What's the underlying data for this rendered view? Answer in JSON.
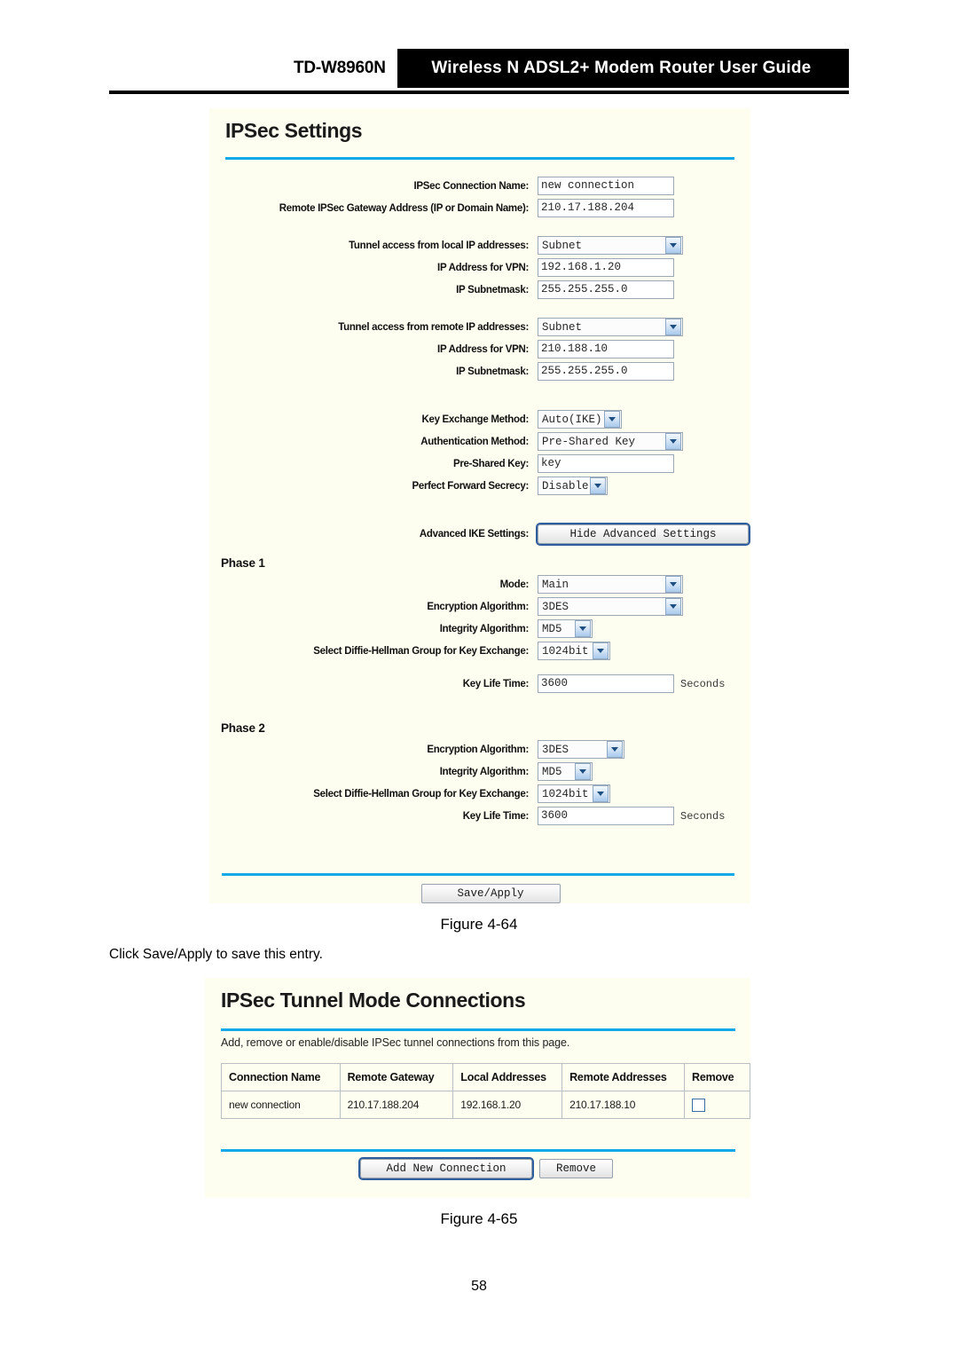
{
  "header": {
    "model": "TD-W8960N",
    "title": "Wireless N ADSL2+ Modem Router User Guide"
  },
  "settings_panel": {
    "title": "IPSec Settings",
    "fields": {
      "connection_name": {
        "label": "IPSec Connection Name:",
        "value": "new connection"
      },
      "remote_gateway": {
        "label": "Remote IPSec Gateway Address (IP or Domain Name):",
        "value": "210.17.188.204"
      },
      "local_tunnel_access": {
        "label": "Tunnel access from local IP addresses:",
        "value": "Subnet"
      },
      "local_ip_vpn": {
        "label": "IP Address for VPN:",
        "value": "192.168.1.20"
      },
      "local_subnetmask": {
        "label": "IP Subnetmask:",
        "value": "255.255.255.0"
      },
      "remote_tunnel_access": {
        "label": "Tunnel access from remote IP addresses:",
        "value": "Subnet"
      },
      "remote_ip_vpn": {
        "label": "IP Address for VPN:",
        "value": "210.188.10"
      },
      "remote_subnetmask": {
        "label": "IP Subnetmask:",
        "value": "255.255.255.0"
      },
      "key_exchange_method": {
        "label": "Key Exchange Method:",
        "value": "Auto(IKE)"
      },
      "authentication_method": {
        "label": "Authentication Method:",
        "value": "Pre-Shared Key"
      },
      "pre_shared_key": {
        "label": "Pre-Shared Key:",
        "value": "key"
      },
      "perfect_forward_secrecy": {
        "label": "Perfect Forward Secrecy:",
        "value": "Disable"
      },
      "advanced_ike": {
        "label": "Advanced IKE Settings:",
        "button": "Hide Advanced Settings"
      }
    },
    "phase1": {
      "heading": "Phase 1",
      "mode": {
        "label": "Mode:",
        "value": "Main"
      },
      "encryption_algorithm": {
        "label": "Encryption Algorithm:",
        "value": "3DES"
      },
      "integrity_algorithm": {
        "label": "Integrity Algorithm:",
        "value": "MD5"
      },
      "diffie_hellman": {
        "label": "Select Diffie-Hellman Group for Key Exchange:",
        "value": "1024bit"
      },
      "key_life_time": {
        "label": "Key Life Time:",
        "value": "3600",
        "unit": "Seconds"
      }
    },
    "phase2": {
      "heading": "Phase 2",
      "encryption_algorithm": {
        "label": "Encryption Algorithm:",
        "value": "3DES"
      },
      "integrity_algorithm": {
        "label": "Integrity Algorithm:",
        "value": "MD5"
      },
      "diffie_hellman": {
        "label": "Select Diffie-Hellman Group for Key Exchange:",
        "value": "1024bit"
      },
      "key_life_time": {
        "label": "Key Life Time:",
        "value": "3600",
        "unit": "Seconds"
      }
    },
    "save_button": "Save/Apply"
  },
  "connections_panel": {
    "title": "IPSec Tunnel Mode Connections",
    "description": "Add, remove or enable/disable IPSec tunnel connections from this page.",
    "table": {
      "columns": [
        "Connection Name",
        "Remote Gateway",
        "Local Addresses",
        "Remote Addresses",
        "Remove"
      ],
      "rows": [
        {
          "connection_name": "new connection",
          "remote_gateway": "210.17.188.204",
          "local_addresses": "192.168.1.20",
          "remote_addresses": "210.17.188.10",
          "remove_checked": false
        }
      ]
    },
    "add_button": "Add New Connection",
    "remove_button": "Remove"
  },
  "captions": {
    "figure_64": "Figure 4-64",
    "figure_65": "Figure 4-65"
  },
  "body_text": "Click Save/Apply to save this entry.",
  "page_number": "58",
  "colors": {
    "accent_rule": "#13a9e8",
    "panel_background": "#fdfdf0",
    "header_bar": "#000000"
  }
}
